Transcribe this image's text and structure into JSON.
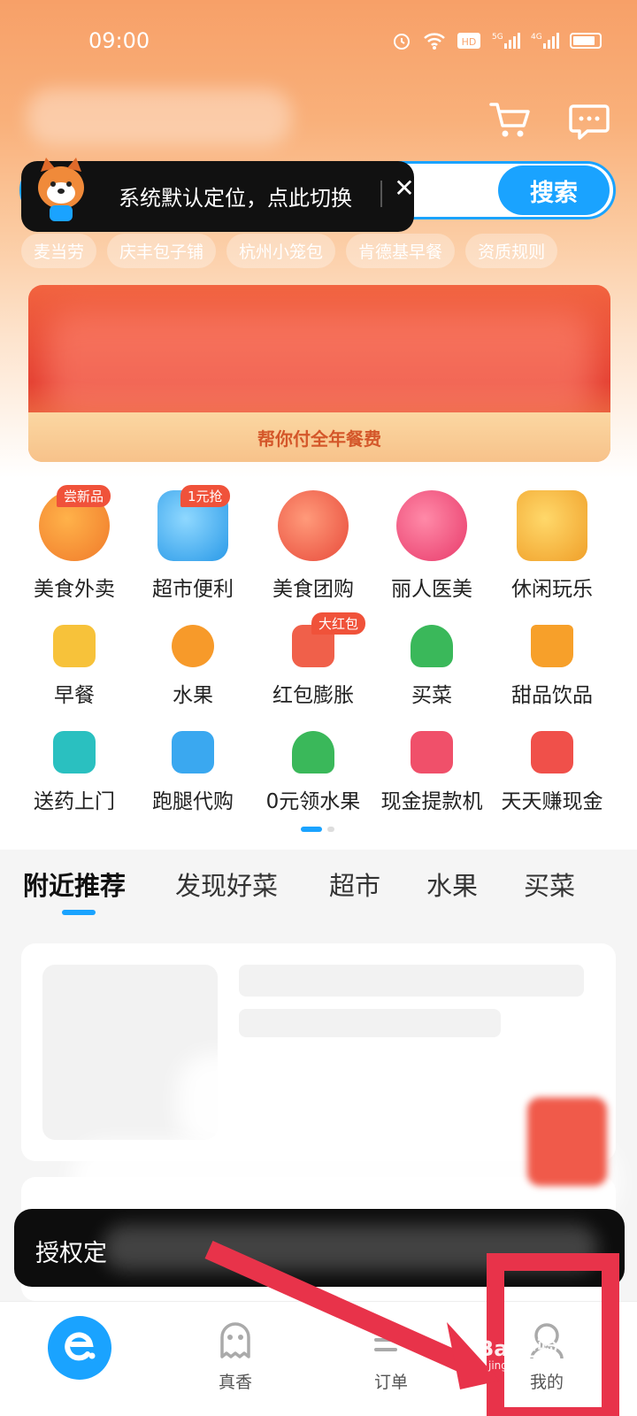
{
  "status_bar": {
    "time": "09:00"
  },
  "search": {
    "button_label": "搜索"
  },
  "location_tip": {
    "text": "系统默认定位，点此切换",
    "close": "✕"
  },
  "hot_keywords": [
    "麦当劳",
    "庆丰包子铺",
    "杭州小笼包",
    "肯德基早餐",
    "资质规则"
  ],
  "banner": {
    "caption": "帮你付全年餐费"
  },
  "categories_row1": [
    {
      "label": "美食外卖",
      "badge": "尝新品",
      "color": "#f59a3a"
    },
    {
      "label": "超市便利",
      "badge": "1元抢",
      "color": "#3aa8f0"
    },
    {
      "label": "美食团购",
      "badge": "",
      "color": "#f06a5a"
    },
    {
      "label": "丽人医美",
      "badge": "",
      "color": "#f0507a"
    },
    {
      "label": "休闲玩乐",
      "badge": "",
      "color": "#f5b83a"
    }
  ],
  "categories_row2": [
    {
      "label": "早餐",
      "badge": "",
      "color": "#f7c23a"
    },
    {
      "label": "水果",
      "badge": "",
      "color": "#f79a2a"
    },
    {
      "label": "红包膨胀",
      "badge": "大红包",
      "color": "#f0604a"
    },
    {
      "label": "买菜",
      "badge": "",
      "color": "#3ab85a"
    },
    {
      "label": "甜品饮品",
      "badge": "",
      "color": "#f7a02a"
    }
  ],
  "categories_row3": [
    {
      "label": "送药上门",
      "badge": "",
      "color": "#2ac0c0"
    },
    {
      "label": "跑腿代购",
      "badge": "",
      "color": "#3aa8f0"
    },
    {
      "label": "0元领水果",
      "badge": "",
      "color": "#3ab85a"
    },
    {
      "label": "现金提款机",
      "badge": "",
      "color": "#f0506a"
    },
    {
      "label": "天天赚现金",
      "badge": "",
      "color": "#f0504a"
    }
  ],
  "feed_tabs": [
    "附近推荐",
    "发现好菜",
    "超市",
    "水果",
    "买菜"
  ],
  "toast": {
    "text": "授权定"
  },
  "bottom_nav": {
    "home": "",
    "zhenxiang": "真香",
    "orders": "订单",
    "mine": "我的"
  },
  "watermark": {
    "text": "Bai经验",
    "sub": "jingyan.baidu.com"
  },
  "accent_color": "#1aa3ff",
  "annotation_color": "#e8334a"
}
